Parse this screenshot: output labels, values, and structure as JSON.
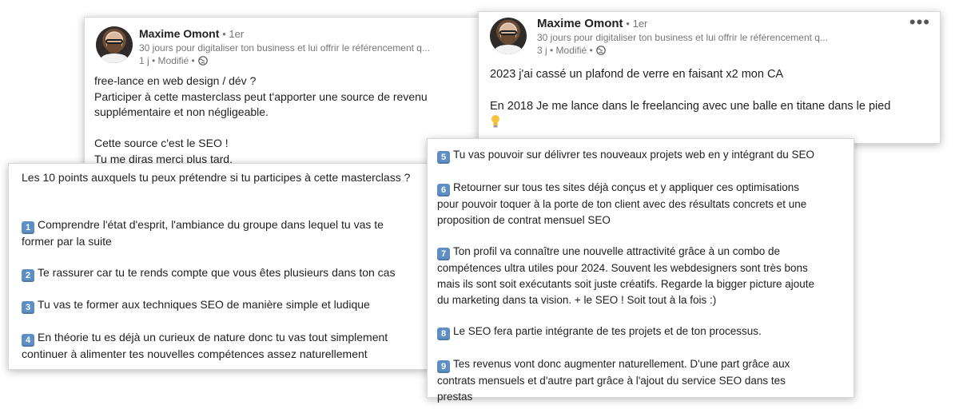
{
  "post1": {
    "author": "Maxime Omont",
    "degree": "• 1er",
    "headline": "30 jours pour digitaliser ton business et lui offrir le référencement q...",
    "meta": "1 j • Modifié •",
    "lines": [
      "free-lance en web design / dév ?",
      "Participer à cette masterclass peut t'apporter une source de revenu",
      "supplémentaire et non négligeable.",
      "",
      "Cette source c'est le SEO !",
      "Tu me diras merci plus tard."
    ]
  },
  "post2": {
    "author": "Maxime Omont",
    "degree": "• 1er",
    "headline": "30 jours pour digitaliser ton business et lui offrir le référencement q...",
    "meta": "3 j • Modifié •",
    "more": "•••",
    "line1": "2023 j'ai cassé un plafond de verre en faisant x2 mon CA",
    "line2": "En 2018 Je me lance dans le freelancing avec une balle en titane dans le pied"
  },
  "points_left": {
    "intro": "Les 10 points auxquels tu peux prétendre si tu participes à cette masterclass ?",
    "items": [
      {
        "n": "1",
        "lines": [
          "Comprendre l'état d'esprit, l'ambiance du groupe dans lequel tu vas te",
          "former par la suite"
        ]
      },
      {
        "n": "2",
        "lines": [
          "Te rassurer car tu te rends compte que vous êtes plusieurs dans ton cas"
        ]
      },
      {
        "n": "3",
        "lines": [
          "Tu vas te former aux techniques SEO de manière simple et ludique"
        ]
      },
      {
        "n": "4",
        "lines": [
          "En théorie tu es déjà un curieux de nature donc tu vas tout simplement",
          "continuer à alimenter tes nouvelles compétences assez naturellement"
        ]
      }
    ]
  },
  "points_right": {
    "items": [
      {
        "n": "5",
        "lines": [
          "Tu vas pouvoir sur délivrer tes nouveaux projets web en y intégrant du SEO"
        ]
      },
      {
        "n": "6",
        "lines": [
          "Retourner sur tous tes sites déjà conçus et y appliquer ces optimisations",
          "pour pouvoir toquer à la porte de ton client avec des résultats concrets et une",
          "proposition de contrat mensuel SEO"
        ]
      },
      {
        "n": "7",
        "lines": [
          "Ton profil va connaître une nouvelle attractivité grâce à un combo de",
          "compétences ultra utiles pour 2024. Souvent les webdesigners sont très bons",
          "mais ils sont soit exécutants soit juste créatifs. Regarde la bigger picture ajoute",
          "du marketing dans ta vision. + le SEO ! Soit tout à la fois :)"
        ]
      },
      {
        "n": "8",
        "lines": [
          "Le SEO fera partie intégrante de tes projets et de ton processus."
        ]
      },
      {
        "n": "9",
        "lines": [
          "Tes revenus vont donc augmenter naturellement. D'une part grâce aux",
          "contrats mensuels et d'autre part grâce à l'ajout du service SEO dans tes",
          "prestas"
        ]
      }
    ]
  },
  "colors": {
    "keycap": "#5d8fc4"
  }
}
